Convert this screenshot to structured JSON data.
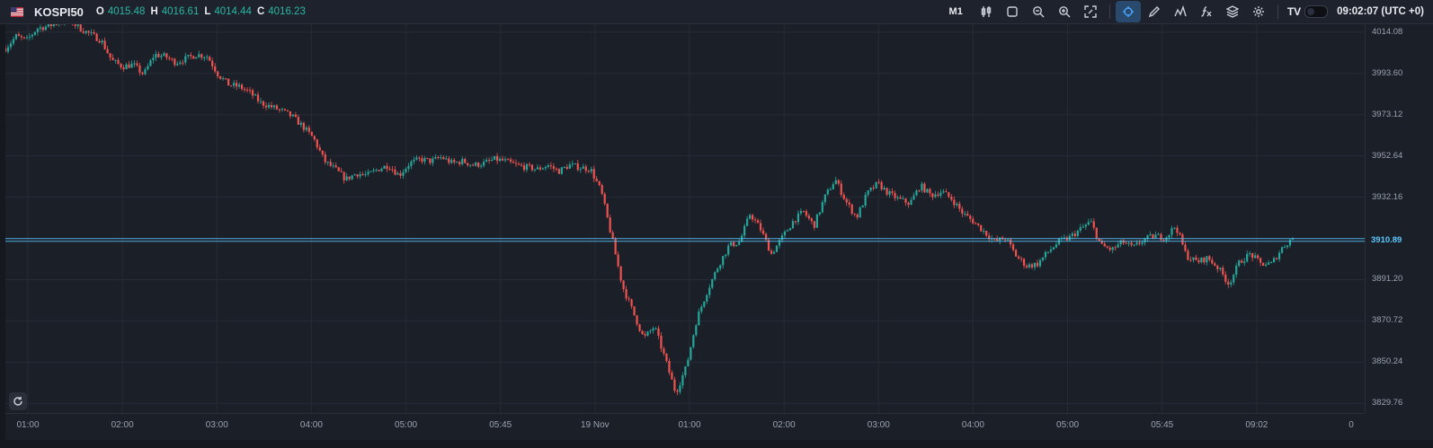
{
  "toolbar": {
    "symbol": "KOSPI50",
    "ohlc": {
      "o_label": "O",
      "o": "4015.48",
      "h_label": "H",
      "h": "4016.61",
      "l_label": "L",
      "l": "4014.44",
      "c_label": "C",
      "c": "4016.23"
    },
    "timeframe": "M1",
    "tools": [
      "candles-icon",
      "rectangle-icon",
      "zoom-out-icon",
      "zoom-in-icon",
      "fullscreen-icon",
      "crosshair-icon",
      "pencil-icon",
      "indicator-icon",
      "fx-icon",
      "layers-icon",
      "settings-icon"
    ],
    "brand": "TV",
    "clock": "09:02:07 (UTC +0)"
  },
  "colors": {
    "up": "#26a69a",
    "down": "#ef5350",
    "accent": "#5cc8ff",
    "grid": "#262b35"
  },
  "price_axis": {
    "labels": [
      "4014.08",
      "3993.60",
      "3973.12",
      "3952.64",
      "3932.16",
      "3891.20",
      "3870.72",
      "3850.24",
      "3829.76"
    ],
    "current": "3910.89"
  },
  "time_axis": {
    "labels": [
      "01:00",
      "02:00",
      "03:00",
      "04:00",
      "05:00",
      "05:45",
      "19 Nov",
      "01:00",
      "02:00",
      "03:00",
      "04:00",
      "05:00",
      "05:45",
      "09:02",
      "0"
    ]
  },
  "chart_data": {
    "type": "candlestick",
    "symbol": "KOSPI50",
    "interval": "M1",
    "ylim": [
      3825,
      4018
    ],
    "horizontal_line": 3910.89,
    "path": [
      [
        0,
        4006
      ],
      [
        2,
        4012
      ],
      [
        4,
        4010
      ],
      [
        6,
        4016
      ],
      [
        8,
        4017
      ],
      [
        10,
        4019
      ],
      [
        12,
        4020
      ],
      [
        14,
        4016
      ],
      [
        16,
        4013
      ],
      [
        18,
        4010
      ],
      [
        20,
        4000
      ],
      [
        22,
        3997
      ],
      [
        24,
        3998
      ],
      [
        26,
        3993
      ],
      [
        28,
        4003
      ],
      [
        30,
        4002
      ],
      [
        32,
        3999
      ],
      [
        34,
        4001
      ],
      [
        36,
        4003
      ],
      [
        38,
        4002
      ],
      [
        40,
        3993
      ],
      [
        42,
        3988
      ],
      [
        44,
        3987
      ],
      [
        46,
        3984
      ],
      [
        48,
        3979
      ],
      [
        50,
        3977
      ],
      [
        52,
        3975
      ],
      [
        54,
        3972
      ],
      [
        56,
        3967
      ],
      [
        58,
        3961
      ],
      [
        60,
        3950
      ],
      [
        62,
        3946
      ],
      [
        64,
        3941
      ],
      [
        66,
        3944
      ],
      [
        68,
        3943
      ],
      [
        70,
        3946
      ],
      [
        72,
        3948
      ],
      [
        74,
        3943
      ],
      [
        76,
        3949
      ],
      [
        78,
        3951
      ],
      [
        80,
        3950
      ],
      [
        82,
        3952
      ],
      [
        84,
        3949
      ],
      [
        86,
        3950
      ],
      [
        88,
        3948
      ],
      [
        90,
        3949
      ],
      [
        92,
        3951
      ],
      [
        94,
        3950
      ],
      [
        96,
        3948
      ],
      [
        98,
        3947
      ],
      [
        100,
        3946
      ],
      [
        102,
        3948
      ],
      [
        104,
        3945
      ],
      [
        106,
        3948
      ],
      [
        108,
        3947
      ],
      [
        110,
        3946
      ],
      [
        112,
        3935
      ],
      [
        114,
        3912
      ],
      [
        116,
        3888
      ],
      [
        118,
        3875
      ],
      [
        120,
        3862
      ],
      [
        122,
        3868
      ],
      [
        124,
        3852
      ],
      [
        126,
        3835
      ],
      [
        128,
        3848
      ],
      [
        130,
        3872
      ],
      [
        132,
        3886
      ],
      [
        134,
        3898
      ],
      [
        136,
        3908
      ],
      [
        138,
        3910
      ],
      [
        140,
        3924
      ],
      [
        142,
        3916
      ],
      [
        144,
        3904
      ],
      [
        146,
        3912
      ],
      [
        148,
        3920
      ],
      [
        150,
        3925
      ],
      [
        152,
        3918
      ],
      [
        154,
        3932
      ],
      [
        156,
        3941
      ],
      [
        158,
        3930
      ],
      [
        160,
        3922
      ],
      [
        162,
        3934
      ],
      [
        164,
        3939
      ],
      [
        166,
        3934
      ],
      [
        168,
        3931
      ],
      [
        170,
        3929
      ],
      [
        172,
        3938
      ],
      [
        174,
        3933
      ],
      [
        176,
        3935
      ],
      [
        178,
        3931
      ],
      [
        180,
        3924
      ],
      [
        182,
        3920
      ],
      [
        184,
        3915
      ],
      [
        186,
        3910
      ],
      [
        188,
        3912
      ],
      [
        190,
        3903
      ],
      [
        192,
        3898
      ],
      [
        194,
        3899
      ],
      [
        196,
        3905
      ],
      [
        198,
        3910
      ],
      [
        200,
        3912
      ],
      [
        202,
        3916
      ],
      [
        204,
        3920
      ],
      [
        206,
        3908
      ],
      [
        208,
        3906
      ],
      [
        210,
        3910
      ],
      [
        212,
        3907
      ],
      [
        214,
        3911
      ],
      [
        216,
        3913
      ],
      [
        218,
        3912
      ],
      [
        220,
        3918
      ],
      [
        222,
        3903
      ],
      [
        224,
        3900
      ],
      [
        226,
        3902
      ],
      [
        228,
        3897
      ],
      [
        230,
        3889
      ],
      [
        232,
        3900
      ],
      [
        234,
        3904
      ],
      [
        236,
        3899
      ],
      [
        238,
        3899
      ],
      [
        240,
        3907
      ],
      [
        242,
        3912
      ]
    ]
  }
}
